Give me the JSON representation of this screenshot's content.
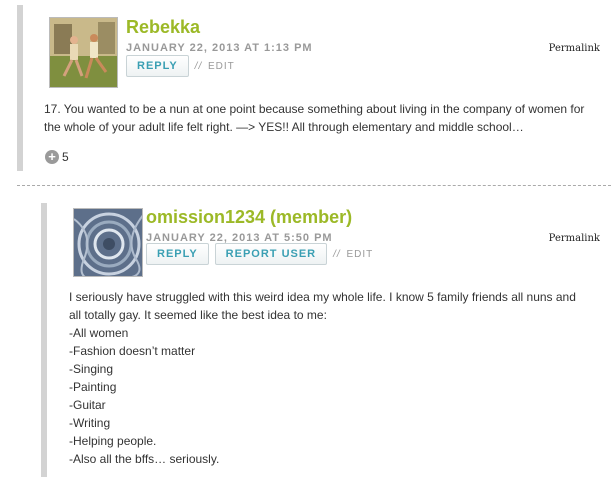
{
  "comments": [
    {
      "author": "Rebekka",
      "date": "JANUARY 22, 2013 AT 1:13 PM",
      "permalink": "Permalink",
      "reply_label": "REPLY",
      "edit_label": "EDIT",
      "edit_prefix": "//",
      "body_lines": [
        "17. You wanted to be a nun at one point because something about living in the company of women for",
        "the whole of your adult life felt right. —> YES!! All through elementary and middle school…"
      ],
      "vote_count": "5"
    },
    {
      "author": "omission1234 (member)",
      "date": "JANUARY 22, 2013 AT 5:50 PM",
      "permalink": "Permalink",
      "reply_label": "REPLY",
      "report_label": "REPORT USER",
      "edit_label": "EDIT",
      "edit_prefix": "//",
      "body_lines": [
        "I seriously have struggled with this weird idea my whole life. I know 5 family friends all nuns and",
        "all totally gay. It seemed like the best idea to me:",
        "-All women",
        "-Fashion doesn’t matter",
        "-Singing",
        "-Painting",
        "-Guitar",
        "-Writing",
        "-Helping people.",
        "-Also all the bffs… seriously."
      ]
    }
  ],
  "colors": {
    "author": "#9cb927",
    "button_text": "#3a9fb3",
    "thread_bar": "#d3d3d3"
  },
  "icons": {
    "vote": "plus-circle-icon"
  }
}
